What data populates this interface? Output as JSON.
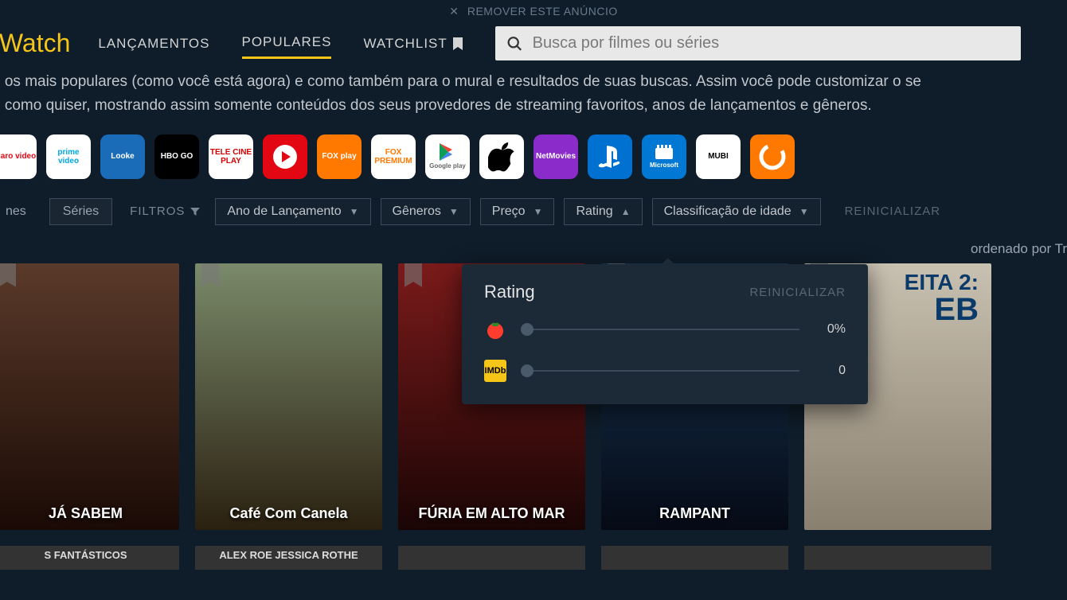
{
  "ad": {
    "text": "REMOVER ESTE ANÚNCIO",
    "close": "✕"
  },
  "logo": "tWatch",
  "nav": {
    "releases": "LANÇAMENTOS",
    "popular": "POPULARES",
    "watchlist": "WATCHLIST"
  },
  "search": {
    "placeholder": "Busca por filmes ou séries"
  },
  "description_line1": "o os mais populares (como você está agora) e como também para o mural e resultados de suas buscas. Assim você pode customizar o se",
  "description_line2": "n como quiser, mostrando assim somente conteúdos dos seus provedores de streaming favoritos, anos de lançamentos e gêneros.",
  "providers": [
    {
      "name": "Claro video",
      "bg": "#ffffff",
      "fg": "#e30613"
    },
    {
      "name": "prime video",
      "bg": "#ffffff",
      "fg": "#00a8e1"
    },
    {
      "name": "Looke",
      "bg": "#1a6bb8",
      "fg": "#ffffff"
    },
    {
      "name": "HBO GO",
      "bg": "#000000",
      "fg": "#ffffff"
    },
    {
      "name": "TELE CINE PLAY",
      "bg": "#ffffff",
      "fg": "#d40000"
    },
    {
      "name": "",
      "bg": "#e30613",
      "fg": "#ffffff"
    },
    {
      "name": "FOX play",
      "bg": "#ff7800",
      "fg": "#ffffff"
    },
    {
      "name": "FOX PREMIUM",
      "bg": "#ffffff",
      "fg": "#ff7800"
    },
    {
      "name": "Google play",
      "bg": "#ffffff",
      "fg": "#555555"
    },
    {
      "name": "",
      "bg": "#ffffff",
      "fg": "#000000"
    },
    {
      "name": "NetMovies",
      "bg": "#8b2bc9",
      "fg": "#ffffff"
    },
    {
      "name": "",
      "bg": "#0070d1",
      "fg": "#ffffff"
    },
    {
      "name": "Microsoft",
      "bg": "#0078d4",
      "fg": "#ffffff"
    },
    {
      "name": "MUBI",
      "bg": "#ffffff",
      "fg": "#000000"
    },
    {
      "name": "",
      "bg": "#ff7800",
      "fg": "#ffffff"
    }
  ],
  "tabs": {
    "movies": "nes",
    "series": "Séries"
  },
  "filters": {
    "label": "FILTROS",
    "year": "Ano de Lançamento",
    "genres": "Gêneros",
    "price": "Preço",
    "rating": "Rating",
    "age": "Classificação de idade",
    "reset": "REINICIALIZAR"
  },
  "sort": {
    "label": "ordenado por",
    "value": "Tr"
  },
  "posters_row1": [
    {
      "title": "JÁ SABEM",
      "bg1": "#5a3a2a",
      "bg2": "#1a0a05"
    },
    {
      "title": "Café Com Canela",
      "bg1": "#7a8a6a",
      "bg2": "#2a2010"
    },
    {
      "title": "FÚRIA EM ALTO MAR",
      "bg1": "#7a1a1a",
      "bg2": "#1a0505"
    },
    {
      "title": "RAMPANT",
      "bg1": "#1a3a5a",
      "bg2": "#050a15"
    },
    {
      "title": "EB",
      "bg1": "#c8c0b0",
      "bg2": "#8a8070"
    }
  ],
  "posters_row2": [
    {
      "title": "S FANTÁSTICOS"
    },
    {
      "title": "ALEX ROE   JESSICA ROTHE"
    },
    {
      "title": ""
    },
    {
      "title": ""
    },
    {
      "title": ""
    }
  ],
  "rating_popup": {
    "title": "Rating",
    "reset": "REINICIALIZAR",
    "tomato_value": "0%",
    "imdb_label": "IMDb",
    "imdb_value": "0"
  }
}
